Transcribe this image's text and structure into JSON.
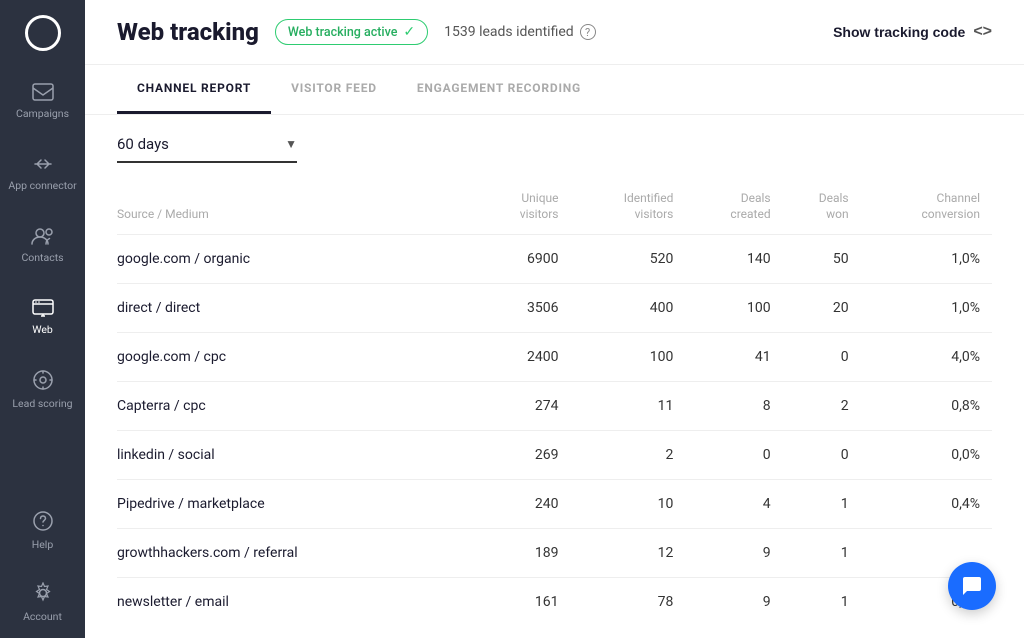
{
  "sidebar": {
    "logo_label": "logo",
    "items": [
      {
        "id": "campaigns",
        "label": "Campaigns",
        "icon": "✉"
      },
      {
        "id": "app-connector",
        "label": "App connector",
        "icon": "⇄"
      },
      {
        "id": "contacts",
        "label": "Contacts",
        "icon": "👥"
      },
      {
        "id": "web",
        "label": "Web",
        "icon": "🖥",
        "active": true
      },
      {
        "id": "lead-scoring",
        "label": "Lead scoring",
        "icon": "⊙"
      },
      {
        "id": "help",
        "label": "Help",
        "icon": "?"
      },
      {
        "id": "account",
        "label": "Account",
        "icon": "⚙"
      }
    ]
  },
  "header": {
    "title": "Web tracking",
    "status_label": "Web tracking active",
    "leads_count": "1539 leads identified",
    "show_tracking_label": "Show tracking code"
  },
  "tabs": [
    {
      "id": "channel-report",
      "label": "Channel Report",
      "active": true
    },
    {
      "id": "visitor-feed",
      "label": "Visitor Feed",
      "active": false
    },
    {
      "id": "engagement-recording",
      "label": "Engagement Recording",
      "active": false
    }
  ],
  "filter": {
    "days_label": "60 days"
  },
  "table": {
    "columns": [
      {
        "id": "source",
        "label": "Source / Medium"
      },
      {
        "id": "unique-visitors",
        "label": "Unique\nvisitors"
      },
      {
        "id": "identified-visitors",
        "label": "Identified\nvisitors"
      },
      {
        "id": "deals-created",
        "label": "Deals\ncreated"
      },
      {
        "id": "deals-won",
        "label": "Deals\nwon"
      },
      {
        "id": "channel-conversion",
        "label": "Channel\nconversion"
      }
    ],
    "rows": [
      {
        "source": "google.com / organic",
        "unique_visitors": "6900",
        "identified_visitors": "520",
        "deals_created": "140",
        "deals_won": "50",
        "channel_conversion": "1,0%"
      },
      {
        "source": "direct / direct",
        "unique_visitors": "3506",
        "identified_visitors": "400",
        "deals_created": "100",
        "deals_won": "20",
        "channel_conversion": "1,0%"
      },
      {
        "source": "google.com / cpc",
        "unique_visitors": "2400",
        "identified_visitors": "100",
        "deals_created": "41",
        "deals_won": "0",
        "channel_conversion": "4,0%"
      },
      {
        "source": "Capterra / cpc",
        "unique_visitors": "274",
        "identified_visitors": "11",
        "deals_created": "8",
        "deals_won": "2",
        "channel_conversion": "0,8%"
      },
      {
        "source": "linkedin / social",
        "unique_visitors": "269",
        "identified_visitors": "2",
        "deals_created": "0",
        "deals_won": "0",
        "channel_conversion": "0,0%"
      },
      {
        "source": "Pipedrive / marketplace",
        "unique_visitors": "240",
        "identified_visitors": "10",
        "deals_created": "4",
        "deals_won": "1",
        "channel_conversion": "0,4%"
      },
      {
        "source": "growthhackers.com / referral",
        "unique_visitors": "189",
        "identified_visitors": "12",
        "deals_created": "9",
        "deals_won": "1",
        "channel_conversion": ""
      },
      {
        "source": "newsletter / email",
        "unique_visitors": "161",
        "identified_visitors": "78",
        "deals_created": "9",
        "deals_won": "1",
        "channel_conversion": "0,6%"
      }
    ]
  }
}
